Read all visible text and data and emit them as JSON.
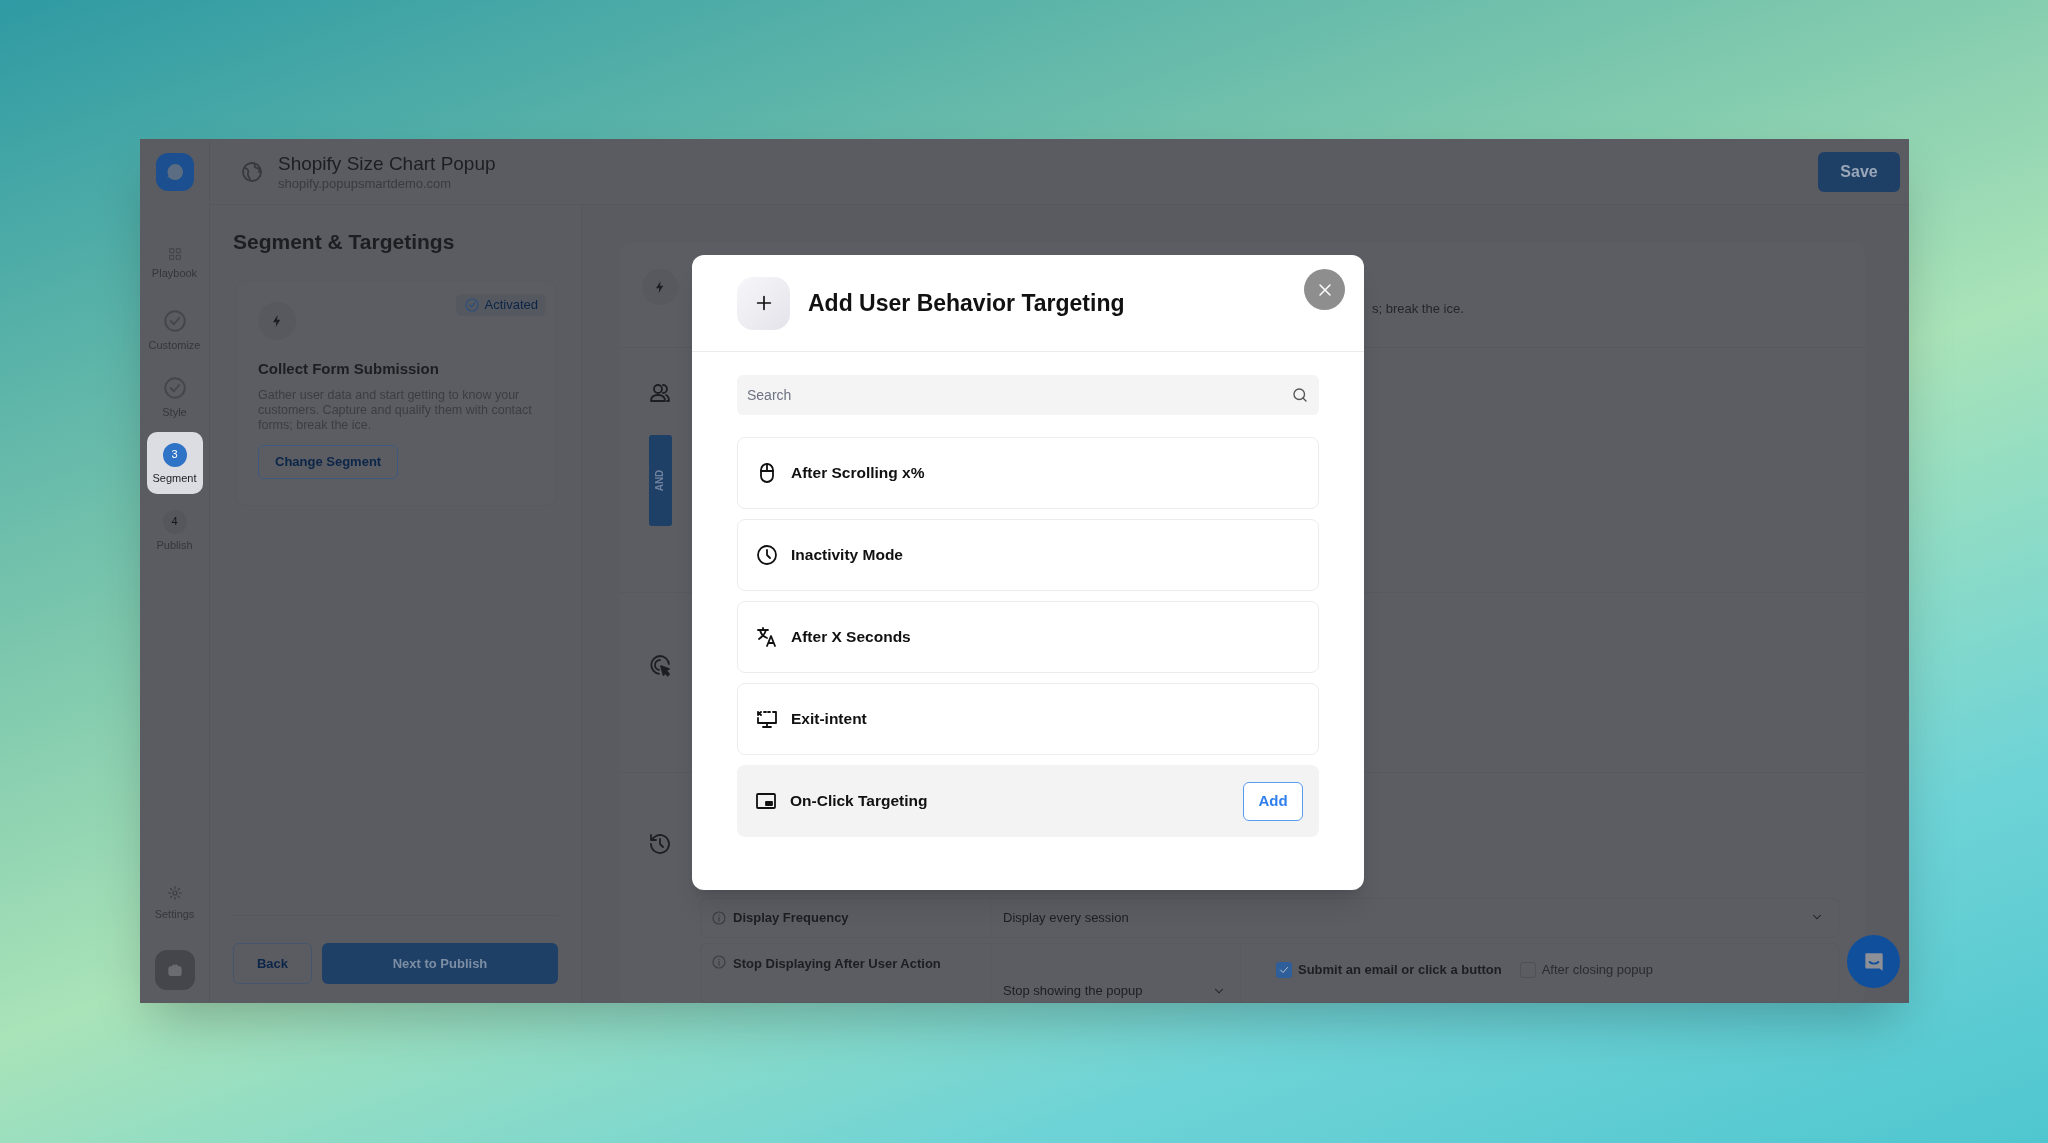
{
  "rail": {
    "steps": [
      {
        "label": "Playbook",
        "kind": "grid",
        "selected": false
      },
      {
        "label": "Customize",
        "kind": "done",
        "selected": false
      },
      {
        "label": "Style",
        "kind": "done",
        "selected": false
      },
      {
        "label": "Segment",
        "kind": "current",
        "number": "3",
        "selected": true
      },
      {
        "label": "Publish",
        "kind": "pending",
        "number": "4",
        "selected": false
      }
    ],
    "settings": "Settings"
  },
  "header": {
    "title": "Shopify Size Chart Popup",
    "url": "shopify.popupsmartdemo.com",
    "save_button": "Save"
  },
  "panel": {
    "title": "Segment & Targetings",
    "card": {
      "badge": "Activated",
      "title": "Collect Form Submission",
      "description": "Gather user data and start getting to know your customers. Capture and qualify them with contact forms; break the ice.",
      "button": "Change Segment"
    },
    "back_button": "Back",
    "next_button": "Next to Publish"
  },
  "main": {
    "description_fragment": "s; break the ice.",
    "connector": "AND",
    "settings": [
      {
        "label": "Display Frequency",
        "value": "Display every session"
      },
      {
        "label": "Stop Displaying After User Action",
        "value": "Stop showing the popup",
        "options": [
          {
            "label": "Submit an email or click a button",
            "checked": true
          },
          {
            "label": "After closing popup",
            "checked": false
          }
        ]
      }
    ]
  },
  "modal": {
    "title": "Add User Behavior Targeting",
    "search": {
      "placeholder": "Search"
    },
    "items": [
      {
        "label": "After Scrolling x%",
        "selected": false
      },
      {
        "label": "Inactivity Mode",
        "selected": false
      },
      {
        "label": "After X Seconds",
        "selected": false
      },
      {
        "label": "Exit-intent",
        "selected": false
      },
      {
        "label": "On-Click Targeting",
        "selected": true
      }
    ],
    "add_button": "Add"
  }
}
